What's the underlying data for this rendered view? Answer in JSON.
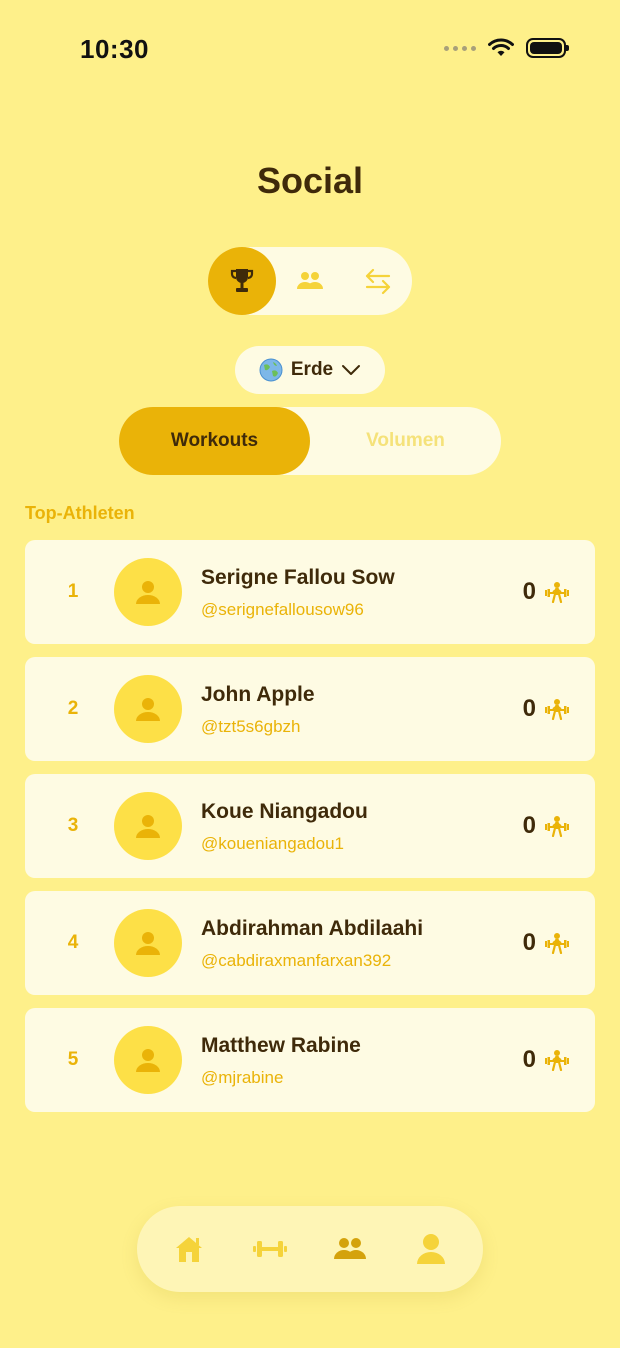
{
  "status_bar": {
    "time": "10:30"
  },
  "page": {
    "title": "Social"
  },
  "view_switcher": {
    "items": [
      {
        "icon": "trophy-icon",
        "active": true
      },
      {
        "icon": "users-icon",
        "active": false
      },
      {
        "icon": "swap-arrows-icon",
        "active": false
      }
    ]
  },
  "region_selector": {
    "icon": "globe-icon",
    "label": "Erde"
  },
  "metric_toggle": {
    "options": [
      "Workouts",
      "Volumen"
    ],
    "selected": "Workouts"
  },
  "leaderboard": {
    "section_label": "Top-Athleten",
    "rows": [
      {
        "rank": "1",
        "name": "Serigne Fallou Sow",
        "handle": "@serignefallousow96",
        "score": "0"
      },
      {
        "rank": "2",
        "name": "John Apple",
        "handle": "@tzt5s6gbzh",
        "score": "0"
      },
      {
        "rank": "3",
        "name": "Koue Niangadou",
        "handle": "@koueniangadou1",
        "score": "0"
      },
      {
        "rank": "4",
        "name": "Abdirahman Abdilaahi",
        "handle": "@cabdiraxmanfarxan392",
        "score": "0"
      },
      {
        "rank": "5",
        "name": "Matthew Rabine",
        "handle": "@mjrabine",
        "score": "0"
      }
    ]
  },
  "bottom_nav": {
    "items": [
      {
        "icon": "home-icon",
        "active": false
      },
      {
        "icon": "dumbbell-icon",
        "active": false
      },
      {
        "icon": "users-icon",
        "active": true
      },
      {
        "icon": "profile-icon",
        "active": false
      }
    ]
  },
  "colors": {
    "background": "#FEF08A",
    "accent": "#EAB308",
    "text": "#3F2A0A",
    "card": "#FEFBE3"
  }
}
